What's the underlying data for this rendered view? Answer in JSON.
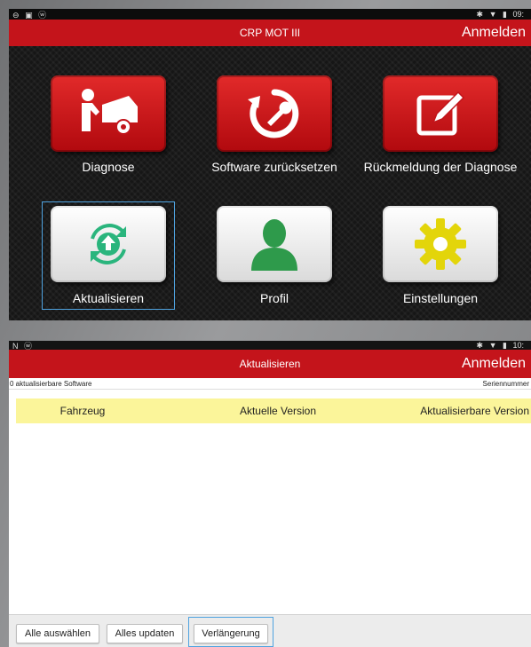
{
  "screen1": {
    "status_left": [
      "⊖",
      "▣",
      "ⓦ"
    ],
    "status_right": [
      "✱",
      "▼",
      "▮",
      "09:"
    ],
    "title": "CRP MOT III",
    "signin": "Anmelden",
    "tiles": [
      {
        "label": "Diagnose",
        "icon": "mechanic-car-icon"
      },
      {
        "label": "Software zurücksetzen",
        "icon": "reset-wrench-icon"
      },
      {
        "label": "Rückmeldung der Diagnose",
        "icon": "edit-pencil-icon"
      },
      {
        "label": "Aktualisieren",
        "icon": "update-arrow-icon"
      },
      {
        "label": "Profil",
        "icon": "user-profile-icon"
      },
      {
        "label": "Einstellungen",
        "icon": "settings-gear-icon"
      }
    ],
    "colors": {
      "accent": "#c4141b",
      "update_green": "#2ab57d",
      "profile_green": "#2e9a4b",
      "gear_yellow": "#e3d50a"
    }
  },
  "screen2": {
    "status_left": [
      "N",
      "ⓦ"
    ],
    "status_right": [
      "✱",
      "▼",
      "▮",
      "10:"
    ],
    "title": "Aktualisieren",
    "signin": "Anmelden",
    "count_text": "0 aktualisierbare Software",
    "serial_label": "Seriennummer",
    "columns": [
      "Fahrzeug",
      "Aktuelle Version",
      "Aktualisierbare Version"
    ],
    "rows": [],
    "buttons": [
      "Alle auswählen",
      "Alles updaten",
      "Verlängerung"
    ],
    "colors": {
      "header_bg": "#fbf59a",
      "selection": "#4fa3e0"
    }
  }
}
